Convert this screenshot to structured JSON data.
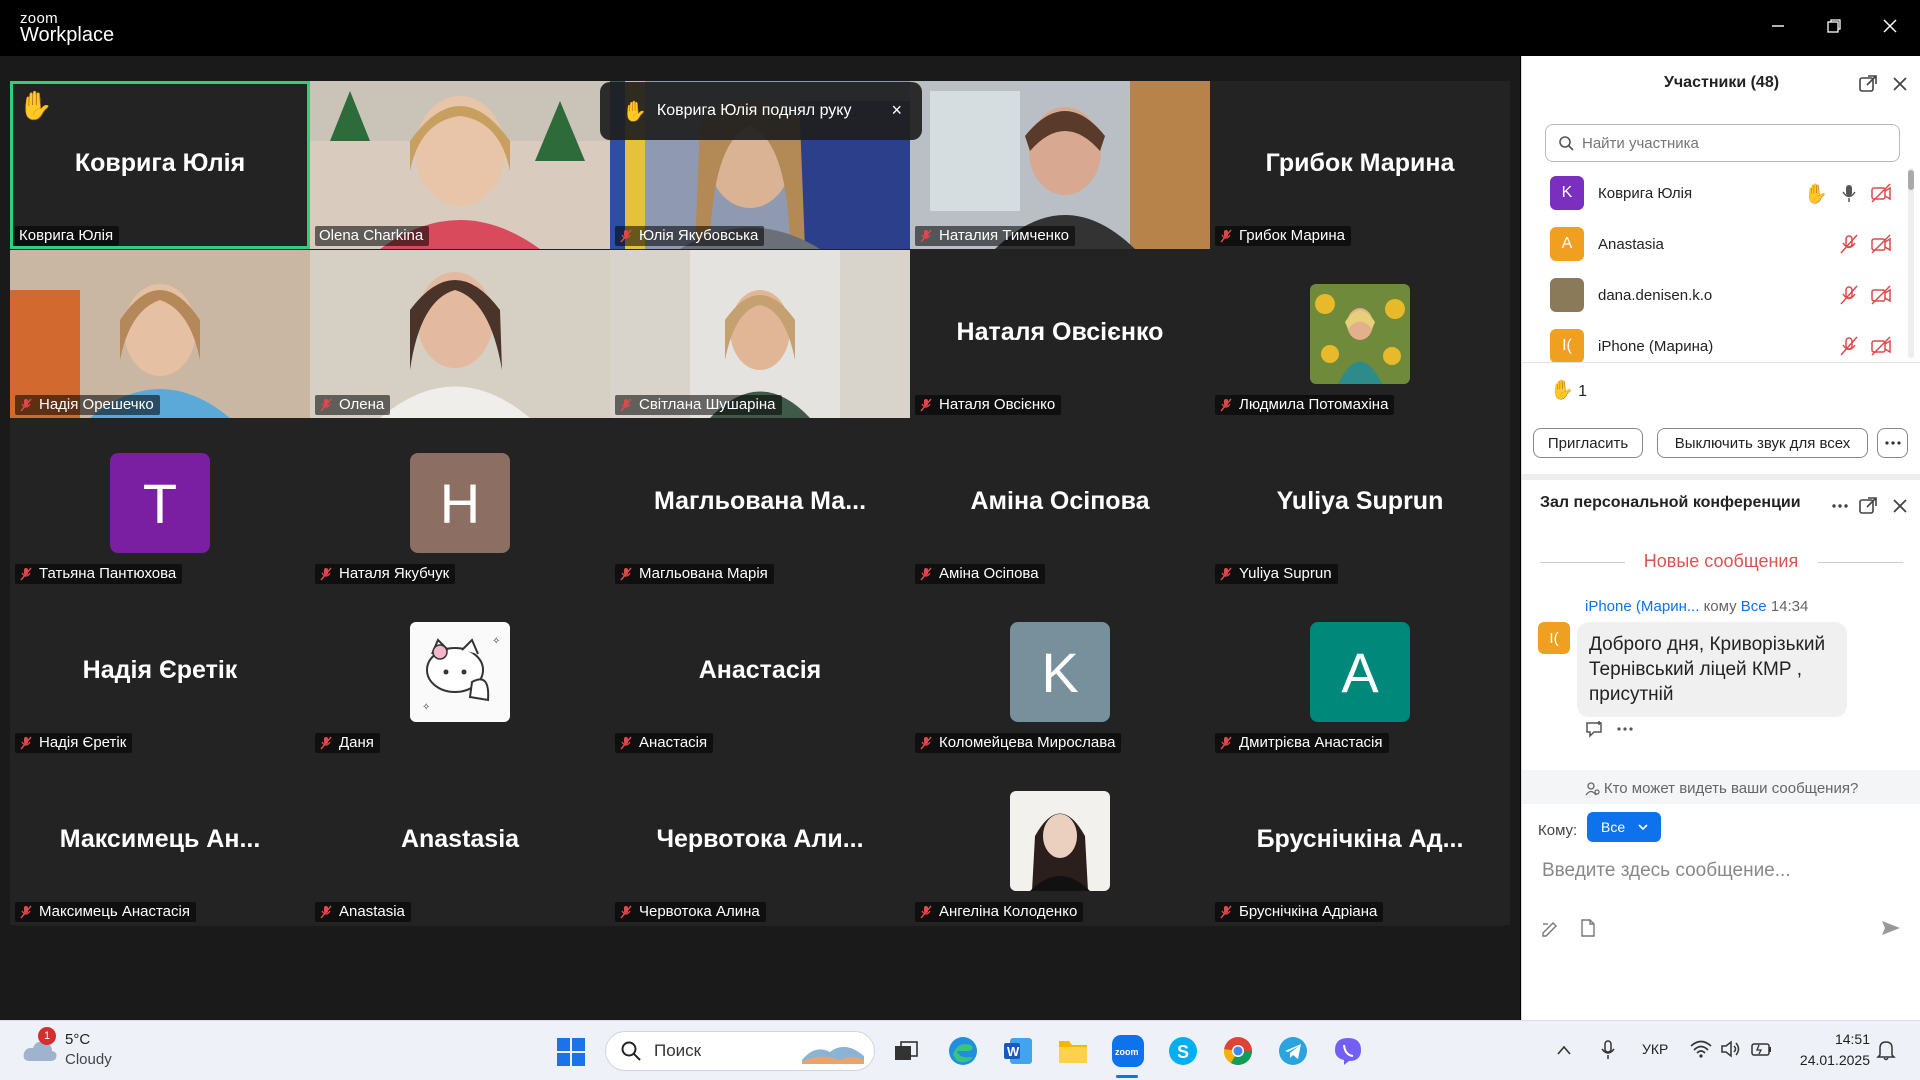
{
  "app": {
    "logo_small": "zoom",
    "logo_big": "Workplace"
  },
  "toast": {
    "text": "Коврига Юлія поднял руку",
    "close": "×"
  },
  "tiles": [
    {
      "big": "Коврига Юлія",
      "label": "Коврига Юлія"
    },
    {
      "label": "Olena Charkina"
    },
    {
      "label": "Юлія Якубовська"
    },
    {
      "label": "Наталия Тимченко"
    },
    {
      "big": "Грибок Марина",
      "label": "Грибок Марина"
    },
    {
      "label": "Надія Орешечко"
    },
    {
      "label": "Олена"
    },
    {
      "label": "Світлана Шушаріна"
    },
    {
      "big": "Наталя Овсієнко",
      "label": "Наталя Овсієнко"
    },
    {
      "label": "Людмила Потомахіна"
    },
    {
      "letter": "T",
      "label": "Татьяна Пантюхова"
    },
    {
      "letter": "H",
      "label": "Наталя Якубчук"
    },
    {
      "big": "Магльована Ма...",
      "label": "Магльована Марія"
    },
    {
      "big": "Аміна Осіпова",
      "label": "Аміна Осіпова"
    },
    {
      "big": "Yuliya Suprun",
      "label": "Yuliya Suprun"
    },
    {
      "big": "Надія Єретік",
      "label": "Надія Єретік"
    },
    {
      "label": "Даня"
    },
    {
      "big": "Анастасія",
      "label": "Анастасія"
    },
    {
      "letter": "K",
      "label": "Коломейцева Мирослава"
    },
    {
      "letter": "A",
      "label": "Дмитрієва Анастасія"
    },
    {
      "big": "Максимець Ан...",
      "label": "Максимець Анастасія"
    },
    {
      "big": "Anastasia",
      "label": "Anastasia"
    },
    {
      "big": "Червотока  Али...",
      "label": "Червотока  Алина"
    },
    {
      "label": "Ангеліна Колоденко"
    },
    {
      "big": "Бруснічкіна Ад...",
      "label": "Бруснічкіна Адріана"
    }
  ],
  "participants_panel": {
    "title": "Участники (48)",
    "search_placeholder": "Найти участника",
    "rows": [
      {
        "initial": "K",
        "name": "Коврига Юлія",
        "color": "#7b2fbe"
      },
      {
        "initial": "A",
        "name": "Anastasia",
        "color": "#f0a020"
      },
      {
        "initial": "",
        "name": "dana.denisen.k.o",
        "color": "#8a7a5a"
      },
      {
        "initial": "I(",
        "name": "iPhone (Марина)",
        "color": "#f0a020"
      }
    ],
    "hands_count": "1",
    "invite_label": "Пригласить",
    "mute_all_label": "Выключить звук для всех"
  },
  "chat": {
    "title": "Зал персональной конференции",
    "new_messages": "Новые сообщения",
    "sender": "iPhone (Марин...",
    "to_word": "кому",
    "to_target": "Все",
    "time": "14:34",
    "avatar_initial": "I(",
    "message": "Доброго дня, Криворізький Тернівський ліцей КМР , присутній",
    "who_sees": "Кто может видеть ваши сообщения?",
    "to_label": "Кому:",
    "to_value": "Все",
    "input_placeholder": "Введите здесь сообщение..."
  },
  "taskbar": {
    "weather_temp": "5°C",
    "weather_cond": "Cloudy",
    "weather_badge": "1",
    "search_label": "Поиск",
    "lang": "УКР",
    "time": "14:51",
    "date": "24.01.2025"
  },
  "colors": {
    "accent": "#0e72ed",
    "active_speaker": "#2fd07a",
    "mic_off": "#e0484c",
    "hand": "#f5c542"
  }
}
